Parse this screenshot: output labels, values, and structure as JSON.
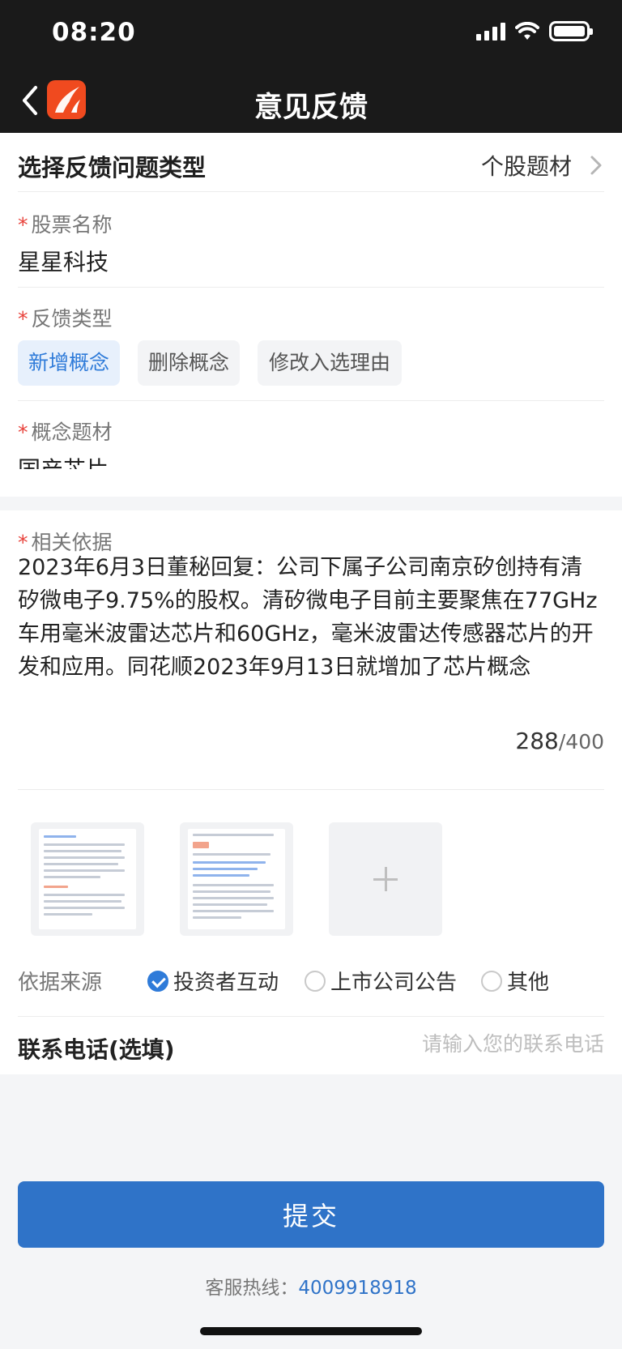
{
  "status_bar": {
    "time": "08:20"
  },
  "nav": {
    "title": "意见反馈"
  },
  "issue_type": {
    "label": "选择反馈问题类型",
    "value": "个股题材"
  },
  "stock": {
    "label": "股票名称",
    "value": "星星科技"
  },
  "feedback_type": {
    "label": "反馈类型",
    "options": [
      "新增概念",
      "删除概念",
      "修改入选理由"
    ],
    "selected": "新增概念"
  },
  "concept": {
    "label": "概念题材",
    "value": "国产芯片"
  },
  "basis": {
    "label": "相关依据",
    "text": "2023年6月3日董秘回复：公司下属子公司南京矽创持有清矽微电子9.75%的股权。清矽微电子目前主要聚焦在77GHz车用毫米波雷达芯片和60GHz，毫米波雷达传感器芯片的开发和应用。同花顺2023年9月13日就增加了芯片概念",
    "count": "288",
    "max": "/400"
  },
  "source": {
    "label": "依据来源",
    "options": [
      "投资者互动",
      "上市公司公告",
      "其他"
    ],
    "selected": "投资者互动"
  },
  "phone": {
    "label": "联系电话(选填)",
    "placeholder": "请输入您的联系电话"
  },
  "submit": {
    "label": "提交"
  },
  "hotline": {
    "label": "客服热线：",
    "number": "4009918918"
  },
  "colors": {
    "accent": "#2f73c8",
    "required": "#e8423b",
    "brand": "#f04a1f"
  }
}
